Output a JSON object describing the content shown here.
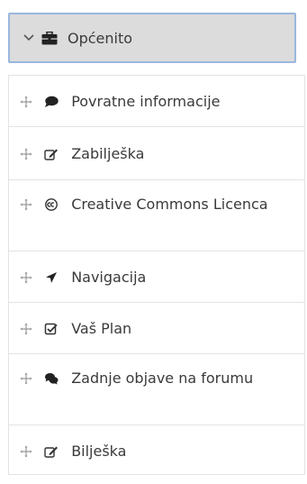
{
  "header": {
    "title": "Općenito",
    "collapse_icon": "chevron-down-icon",
    "icon": "briefcase-icon"
  },
  "items": [
    {
      "label": "Povratne informacije",
      "icon": "comment-icon"
    },
    {
      "label": "Zabilješka",
      "icon": "edit-icon"
    },
    {
      "label": "Creative Commons Licenca",
      "icon": "creative-commons-icon"
    },
    {
      "label": "Navigacija",
      "icon": "location-arrow-icon"
    },
    {
      "label": "Vaš Plan",
      "icon": "check-square-icon"
    },
    {
      "label": "Zadnje objave na forumu",
      "icon": "comments-icon"
    },
    {
      "label": "Bilješka",
      "icon": "edit-icon"
    }
  ],
  "colors": {
    "header_bg": "#dcdcdc",
    "header_border": "#9ab7dd",
    "item_border": "#e3e3e3",
    "text": "#3a3a3a"
  }
}
